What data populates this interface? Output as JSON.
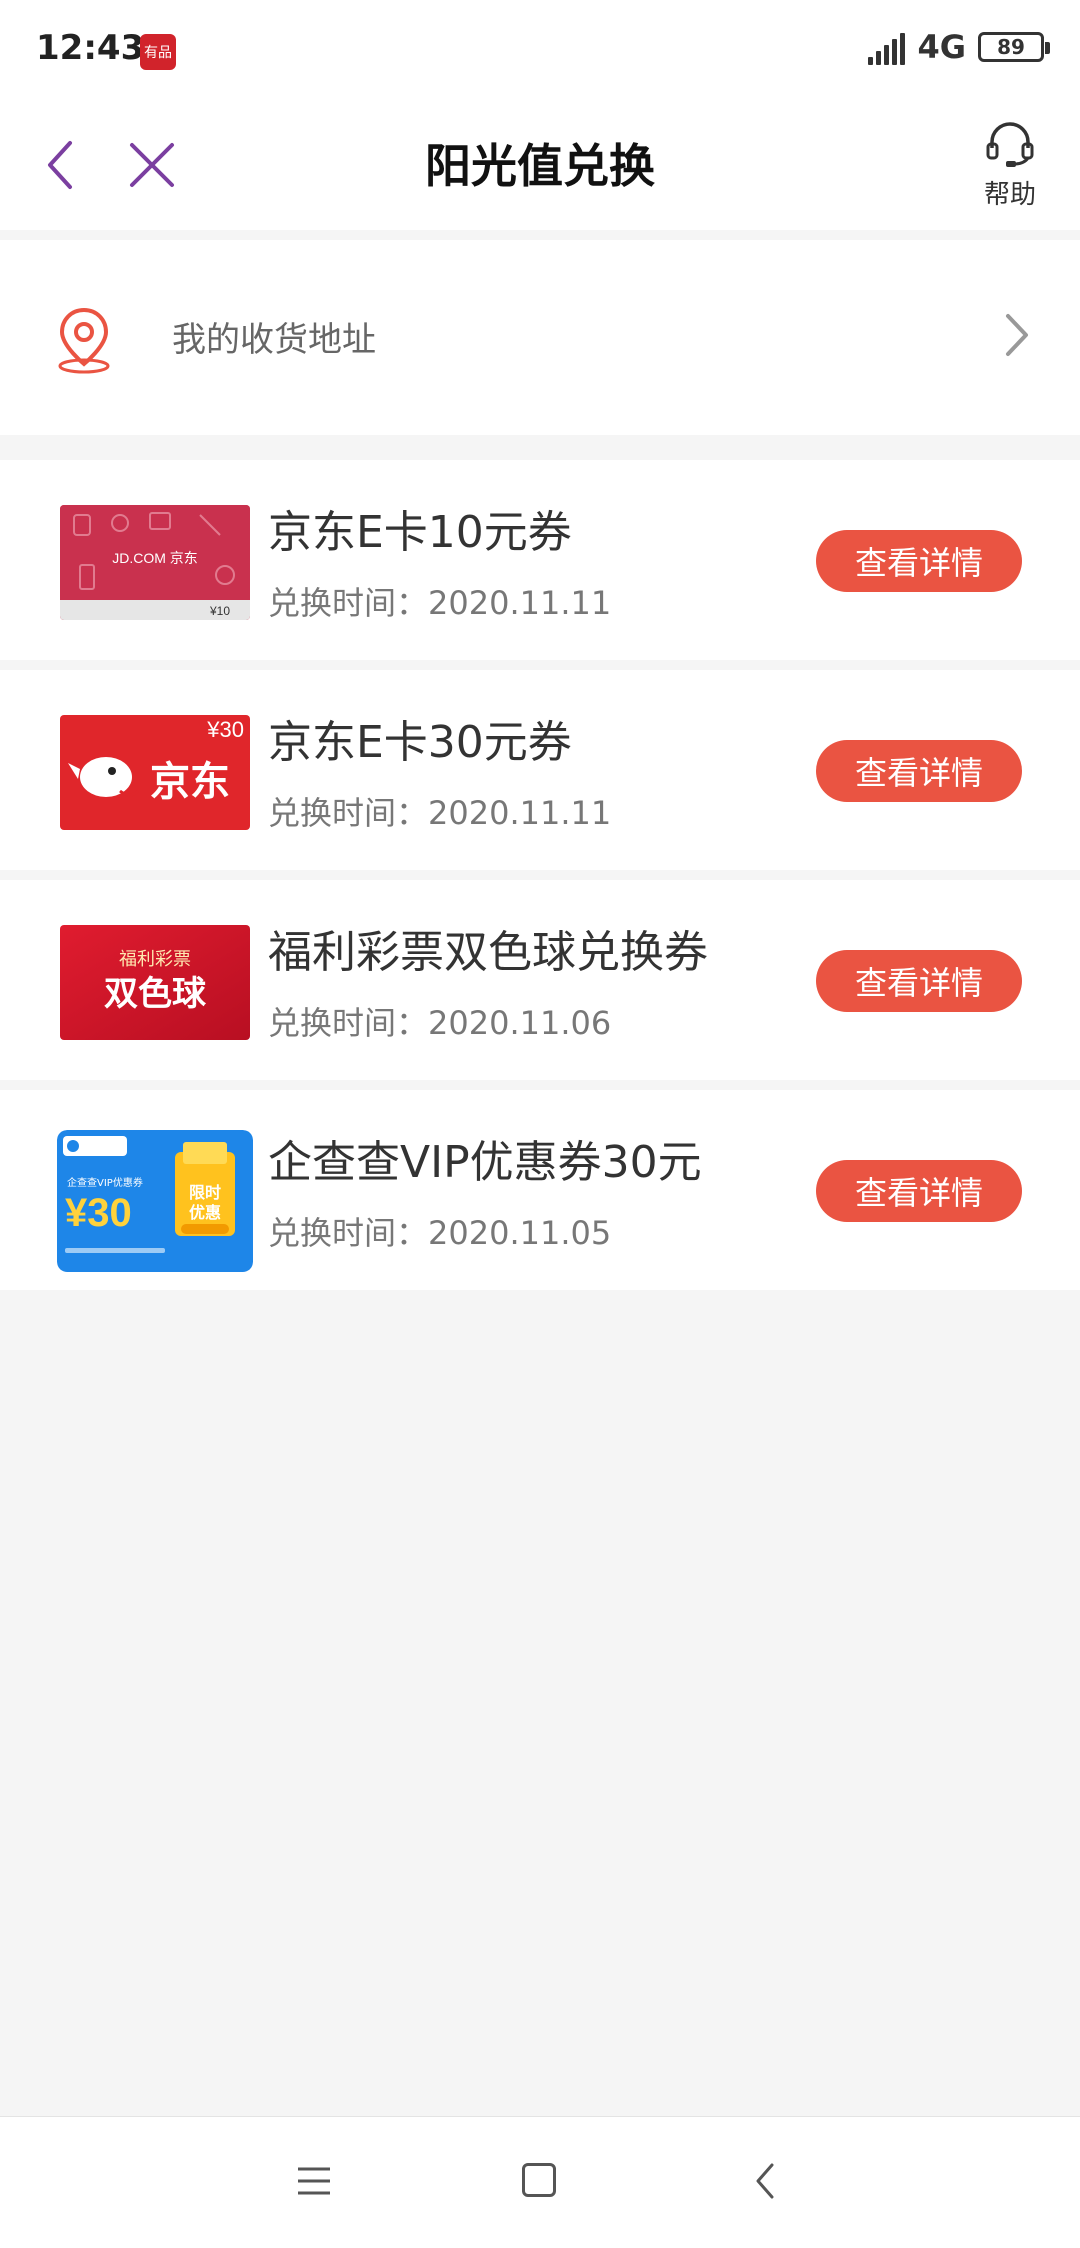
{
  "status_bar": {
    "time": "12:43",
    "app_badge": "有品",
    "network": "4G",
    "battery": "89"
  },
  "header": {
    "title": "阳光值兑换",
    "help_label": "帮助"
  },
  "address": {
    "label": "我的收货地址"
  },
  "items": [
    {
      "title": "京东E卡10元券",
      "time": "兑换时间：2020.11.11",
      "button": "查看详情",
      "thumb_text": "JD.COM 京东",
      "thumb_price": "¥10"
    },
    {
      "title": "京东E卡30元券",
      "time": "兑换时间：2020.11.11",
      "button": "查看详情",
      "thumb_text": "京东",
      "thumb_price": "¥30"
    },
    {
      "title": "福利彩票双色球兑换券",
      "time": "兑换时间：2020.11.06",
      "button": "查看详情",
      "thumb_text": "双色球",
      "thumb_sub": "福利彩票"
    },
    {
      "title": "企查查VIP优惠券30元",
      "time": "兑换时间：2020.11.05",
      "button": "查看详情",
      "thumb_price": "¥30",
      "thumb_tag": "限时优惠",
      "thumb_sub": "企查查VIP优惠券"
    }
  ],
  "colors": {
    "accent": "#ea5442",
    "nav_icon": "#7b3fa0",
    "jd_red": "#e0262b",
    "lottery_red": "#d8172a",
    "qcc_blue": "#1e86e8"
  }
}
